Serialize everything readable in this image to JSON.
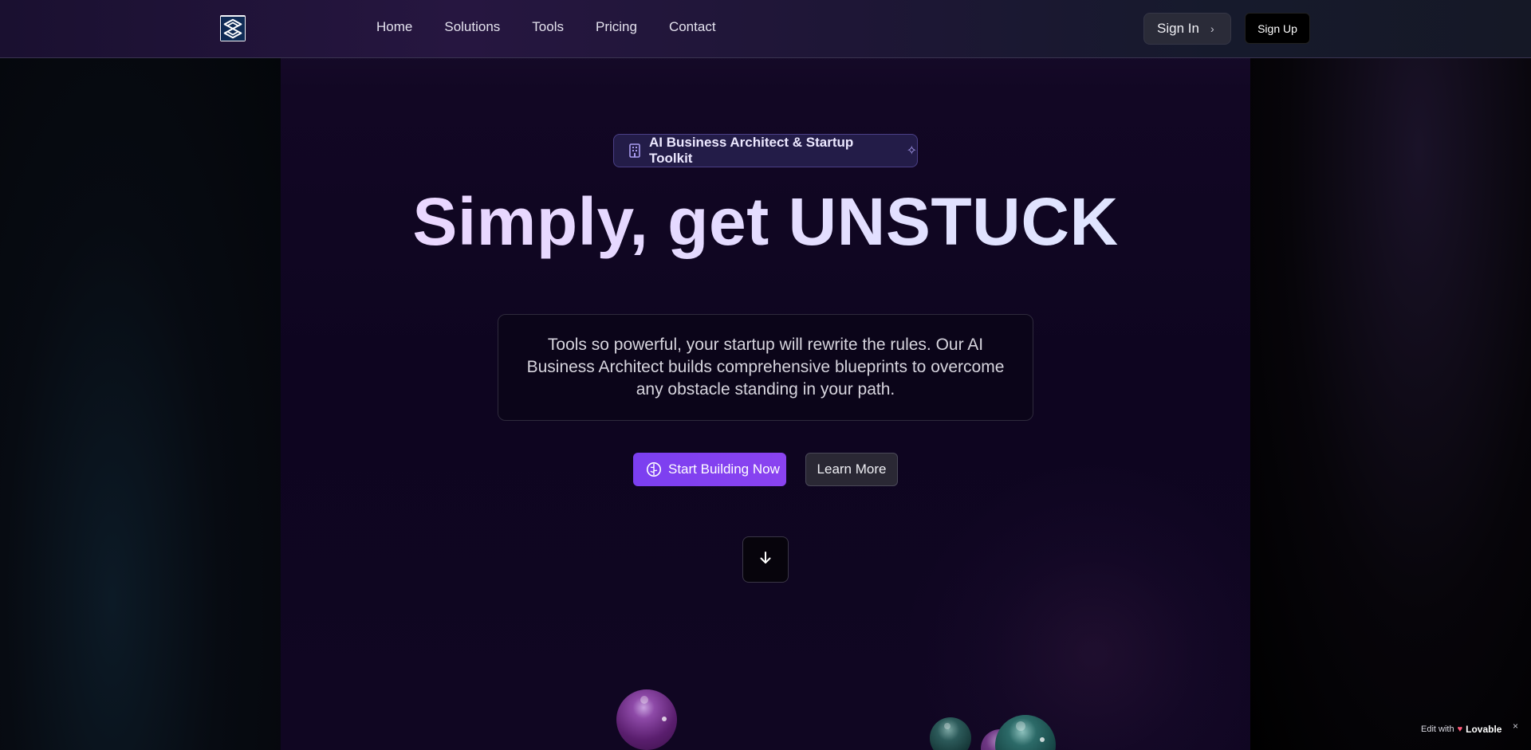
{
  "nav": {
    "logo_icon": "s-brand-logo-icon",
    "links": [
      "Home",
      "Solutions",
      "Tools",
      "Pricing",
      "Contact"
    ],
    "signin_label": "Sign In",
    "signup_label": "Sign Up"
  },
  "hero": {
    "badge_text": "AI Business Architect & Startup Toolkit",
    "badge_icon": "building-icon",
    "badge_trailing_icon": "sparkles-icon",
    "title": "Simply, get UNSTUCK",
    "description": "Tools so powerful, your startup will rewrite the rules. Our AI Business Architect builds comprehensive blueprints to overcome any obstacle standing in your path.",
    "primary_cta": "Start Building Now",
    "primary_cta_icon": "brain-icon",
    "secondary_cta": "Learn More",
    "scroll_icon": "arrow-down-icon"
  },
  "footer_badge": {
    "prefix": "Edit with",
    "brand": "Lovable",
    "close": "×"
  },
  "colors": {
    "primary": "#7b3ff0",
    "badge_bg": "#231c48",
    "background": "#0e0520"
  }
}
